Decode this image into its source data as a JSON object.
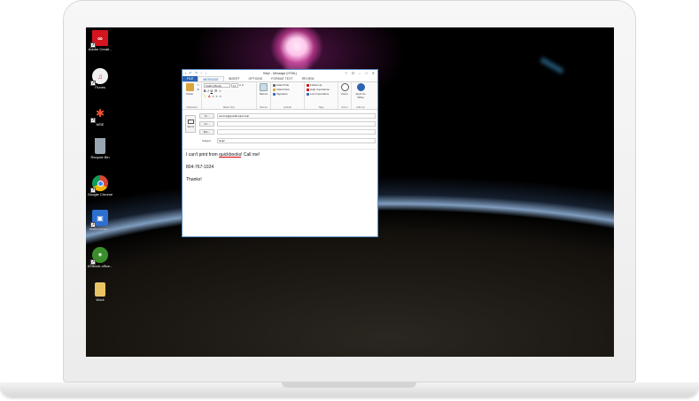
{
  "desktop": {
    "icons": [
      {
        "label": "Adobe Creati...",
        "icon": "adobe-cc-icon",
        "color": "#d4141e"
      },
      {
        "label": "iTunes",
        "icon": "itunes-icon",
        "color": "#e8e8e8"
      },
      {
        "label": "MSE",
        "icon": "mse-icon",
        "color": "#1a1a1a"
      },
      {
        "label": "Recycle Bin",
        "icon": "recycle-bin-icon",
        "color": "#9aa6b2"
      },
      {
        "label": "Google Chrome",
        "icon": "chrome-icon",
        "color": "#2f8f3a"
      },
      {
        "label": "evolv conso...",
        "icon": "evolv-icon",
        "color": "#2d6fd0"
      },
      {
        "label": "ATBlock office...",
        "icon": "atblock-icon",
        "color": "#3a8f2c"
      },
      {
        "label": "Work",
        "icon": "folder-icon",
        "color": "#e8c464"
      }
    ]
  },
  "window": {
    "title": "Help! - Message (HTML)",
    "controls": [
      "?",
      "⊡",
      "–",
      "□",
      "✕"
    ],
    "qat_icons": [
      "save-icon",
      "undo-icon",
      "redo-icon",
      "up-icon",
      "down-icon"
    ],
    "tabs": [
      "FILE",
      "MESSAGE",
      "INSERT",
      "OPTIONS",
      "FORMAT TEXT",
      "REVIEW"
    ],
    "active_tab": "MESSAGE"
  },
  "ribbon": {
    "clipboard": {
      "paste": "Paste",
      "label": "Clipboard"
    },
    "basic_text": {
      "font": "Calibri (Body)",
      "size": "11",
      "bold": "B",
      "italic": "I",
      "underline": "U",
      "label": "Basic Text"
    },
    "names": {
      "button": "Names",
      "label": "Names"
    },
    "include": {
      "items": [
        "Attach File",
        "Attach Item",
        "Signature"
      ],
      "label": "Include"
    },
    "tags": {
      "items": [
        "Follow Up",
        "High Importance",
        "Low Importance"
      ],
      "label": "Tags"
    },
    "zoom": {
      "button": "Zoom",
      "label": "Zoom"
    },
    "addins": {
      "button": "Apps for Office",
      "label": "Add-ins"
    }
  },
  "message": {
    "send_label": "Send",
    "to_label": "To...",
    "to_value": "service@quickbooks.help",
    "cc_label": "Cc...",
    "bcc_label": "Bcc...",
    "subject_label": "Subject",
    "subject_value": "Help!",
    "body": {
      "line1_pre": "I can't print from ",
      "line1_link": "quickbooks",
      "line1_post": "! Call me!",
      "line2": "804-767-1024",
      "line3": "Thanks!"
    }
  }
}
